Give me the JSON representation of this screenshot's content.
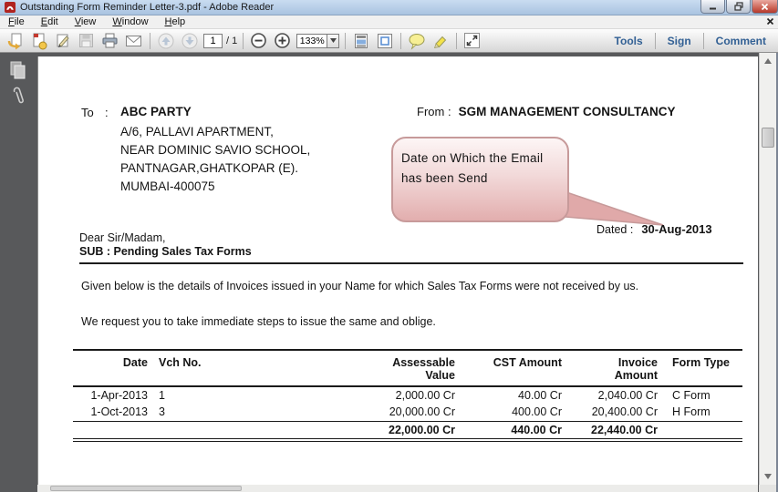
{
  "window": {
    "title": "Outstanding Form Reminder Letter-3.pdf - Adobe Reader",
    "menu": {
      "items": [
        "File",
        "Edit",
        "View",
        "Window",
        "Help"
      ]
    },
    "toolbar": {
      "page_current": "1",
      "page_of": "/ 1",
      "zoom_value": "133%",
      "tools_label": "Tools",
      "sign_label": "Sign",
      "comment_label": "Comment"
    }
  },
  "letter": {
    "to_label": "To",
    "to_separator": ":",
    "recipient": {
      "name": "ABC PARTY",
      "address_lines": [
        "A/6, PALLAVI APARTMENT,",
        "NEAR DOMINIC SAVIO SCHOOL,",
        "PANTNAGAR,GHATKOPAR (E).",
        "MUMBAI-400075"
      ]
    },
    "from_label": "From :",
    "sender_name": "SGM MANAGEMENT CONSULTANCY",
    "callout": {
      "line1": "Date on Which the Email",
      "line2": "has been Send"
    },
    "dated_label": "Dated :",
    "dated_value": "30-Aug-2013",
    "salutation": "Dear Sir/Madam,",
    "subject": "SUB : Pending Sales Tax Forms",
    "body_para1": "Given below is the details of Invoices issued in your Name for which Sales Tax Forms were not received by us.",
    "body_para2": "We request you to take immediate steps to issue the same and oblige.",
    "invoice_table": {
      "headers": {
        "date": "Date",
        "vch": "Vch No.",
        "assessable": "Assessable\nValue",
        "cst": "CST Amount",
        "invoice": "Invoice\nAmount",
        "form": "Form Type"
      },
      "rows": [
        {
          "date": "1-Apr-2013",
          "vch": "1",
          "assessable": "2,000.00 Cr",
          "cst": "40.00 Cr",
          "invoice": "2,040.00 Cr",
          "form": "C Form"
        },
        {
          "date": "1-Oct-2013",
          "vch": "3",
          "assessable": "20,000.00 Cr",
          "cst": "400.00 Cr",
          "invoice": "20,400.00 Cr",
          "form": "H Form"
        }
      ],
      "totals": {
        "assessable": "22,000.00 Cr",
        "cst": "440.00 Cr",
        "invoice": "22,440.00 Cr"
      }
    }
  },
  "colors": {
    "titlebar_blue": "#a9c3e0",
    "callout_fill": "#e2adad",
    "callout_border": "#c79a9a",
    "toolbar_link_blue": "#326094"
  }
}
